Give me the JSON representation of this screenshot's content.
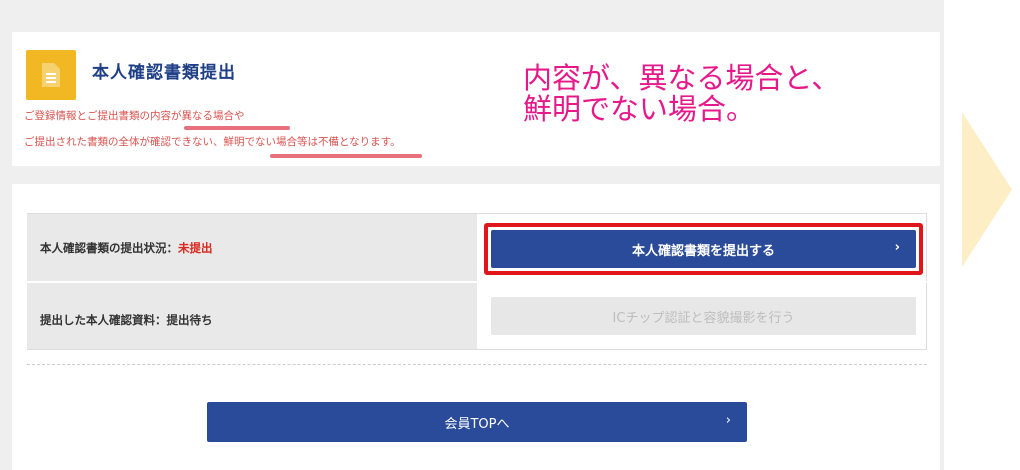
{
  "header": {
    "title": "本人確認書類提出",
    "icon": "document-icon",
    "note_line1": "ご登録情報とご提出書類の内容が異なる場合や",
    "note_line2": "ご提出された書類の全体が確認できない、鮮明でない場合等は不備となります。"
  },
  "annotation": {
    "line1": "内容が、異なる場合と、",
    "line2": "鮮明でない場合。",
    "color": "#e6198b"
  },
  "status_table": {
    "row1": {
      "label": "本人確認書類の提出状況：",
      "status": "未提出",
      "button_label": "本人確認書類を提出する",
      "button_chevron": "›"
    },
    "row2": {
      "label": "提出した本人確認資料：提出待ち",
      "button_label": "ICチップ認証と容貌撮影を行う"
    }
  },
  "footer": {
    "member_top_label": "会員TOPへ",
    "member_top_chevron": "›"
  },
  "colors": {
    "brand_blue": "#2a4b9a",
    "title_blue": "#1f3f86",
    "warning_red": "#d9534f",
    "icon_yellow": "#f2b823",
    "highlight_frame": "#e0161b"
  }
}
